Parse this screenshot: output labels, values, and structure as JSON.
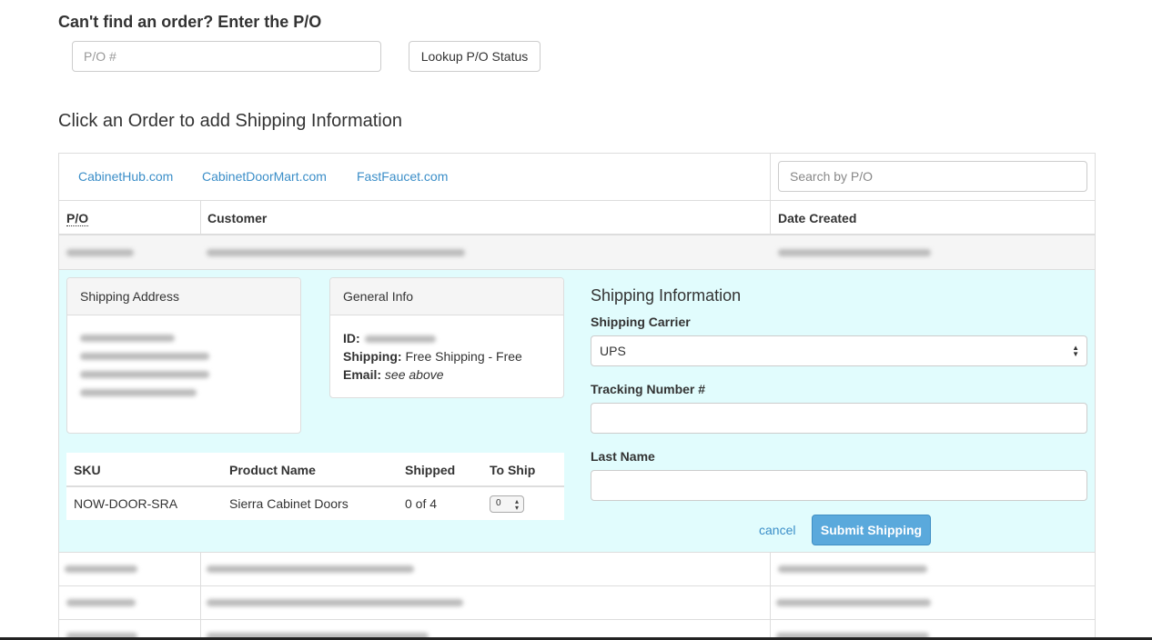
{
  "lookup": {
    "heading": "Can't find an order? Enter the P/O",
    "placeholder": "P/O #",
    "button_label": "Lookup P/O Status"
  },
  "orders": {
    "heading": "Click an Order to add Shipping Information",
    "tabs": [
      "CabinetHub.com",
      "CabinetDoorMart.com",
      "FastFaucet.com"
    ],
    "search_placeholder": "Search by P/O",
    "columns": [
      "P/O",
      "Customer",
      "Date Created"
    ]
  },
  "detail": {
    "shipping_address_title": "Shipping Address",
    "general_info_title": "General Info",
    "id_label": "ID:",
    "shipping_label": "Shipping:",
    "shipping_value": "Free Shipping - Free",
    "email_label": "Email:",
    "email_value": "see above",
    "items_columns": [
      "SKU",
      "Product Name",
      "Shipped",
      "To Ship"
    ],
    "items": [
      {
        "sku": "NOW-DOOR-SRA",
        "product": "Sierra Cabinet Doors",
        "shipped": "0 of 4",
        "to_ship": "0"
      }
    ]
  },
  "shipping_form": {
    "title": "Shipping Information",
    "carrier_label": "Shipping Carrier",
    "carrier_value": "UPS",
    "tracking_label": "Tracking Number #",
    "last_name_label": "Last Name",
    "cancel_label": "cancel",
    "submit_label": "Submit Shipping"
  },
  "colors": {
    "link": "#3b8ec8",
    "expanded_bg": "#e1fcfd",
    "primary_button": "#5aa9dc"
  }
}
